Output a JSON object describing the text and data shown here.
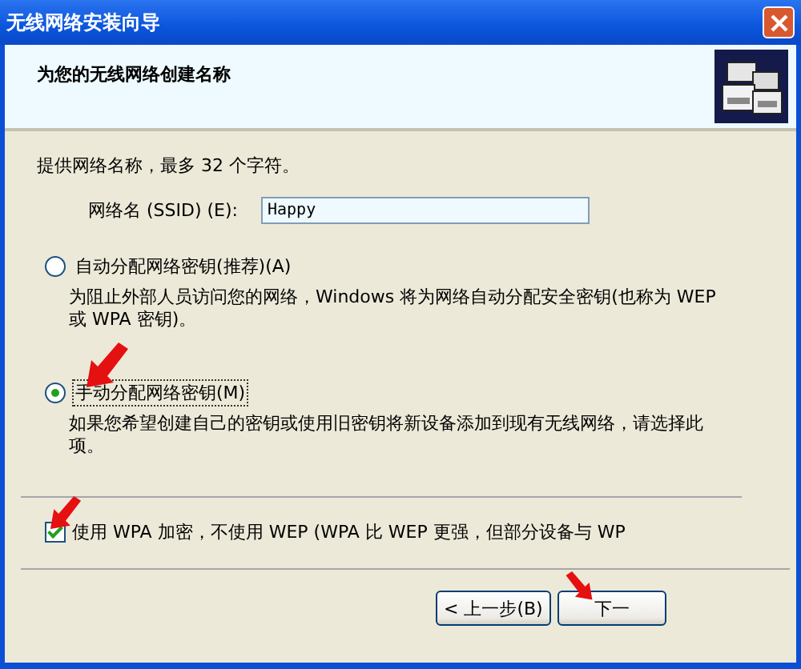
{
  "window": {
    "title": "无线网络安装向导"
  },
  "header": {
    "title": "为您的无线网络创建名称"
  },
  "intro": "提供网络名称，最多 32 个字符。",
  "ssid": {
    "label": "网络名 (SSID) (E):",
    "value": "Happy"
  },
  "key_options": [
    {
      "label": "自动分配网络密钥(推荐)(A)",
      "description": "为阻止外部人员访问您的网络，Windows 将为网络自动分配安全密钥(也称为 WEP 或 WPA 密钥)。",
      "selected": false
    },
    {
      "label": "手动分配网络密钥(M)",
      "description": "如果您希望创建自己的密钥或使用旧密钥将新设备添加到现有无线网络，请选择此项。",
      "selected": true
    }
  ],
  "wpa_checkbox": {
    "label": "使用 WPA 加密，不使用 WEP (WPA 比 WEP 更强，但部分设备与 WP",
    "checked": true
  },
  "buttons": [
    "< 上一步(B)",
    "下一"
  ]
}
